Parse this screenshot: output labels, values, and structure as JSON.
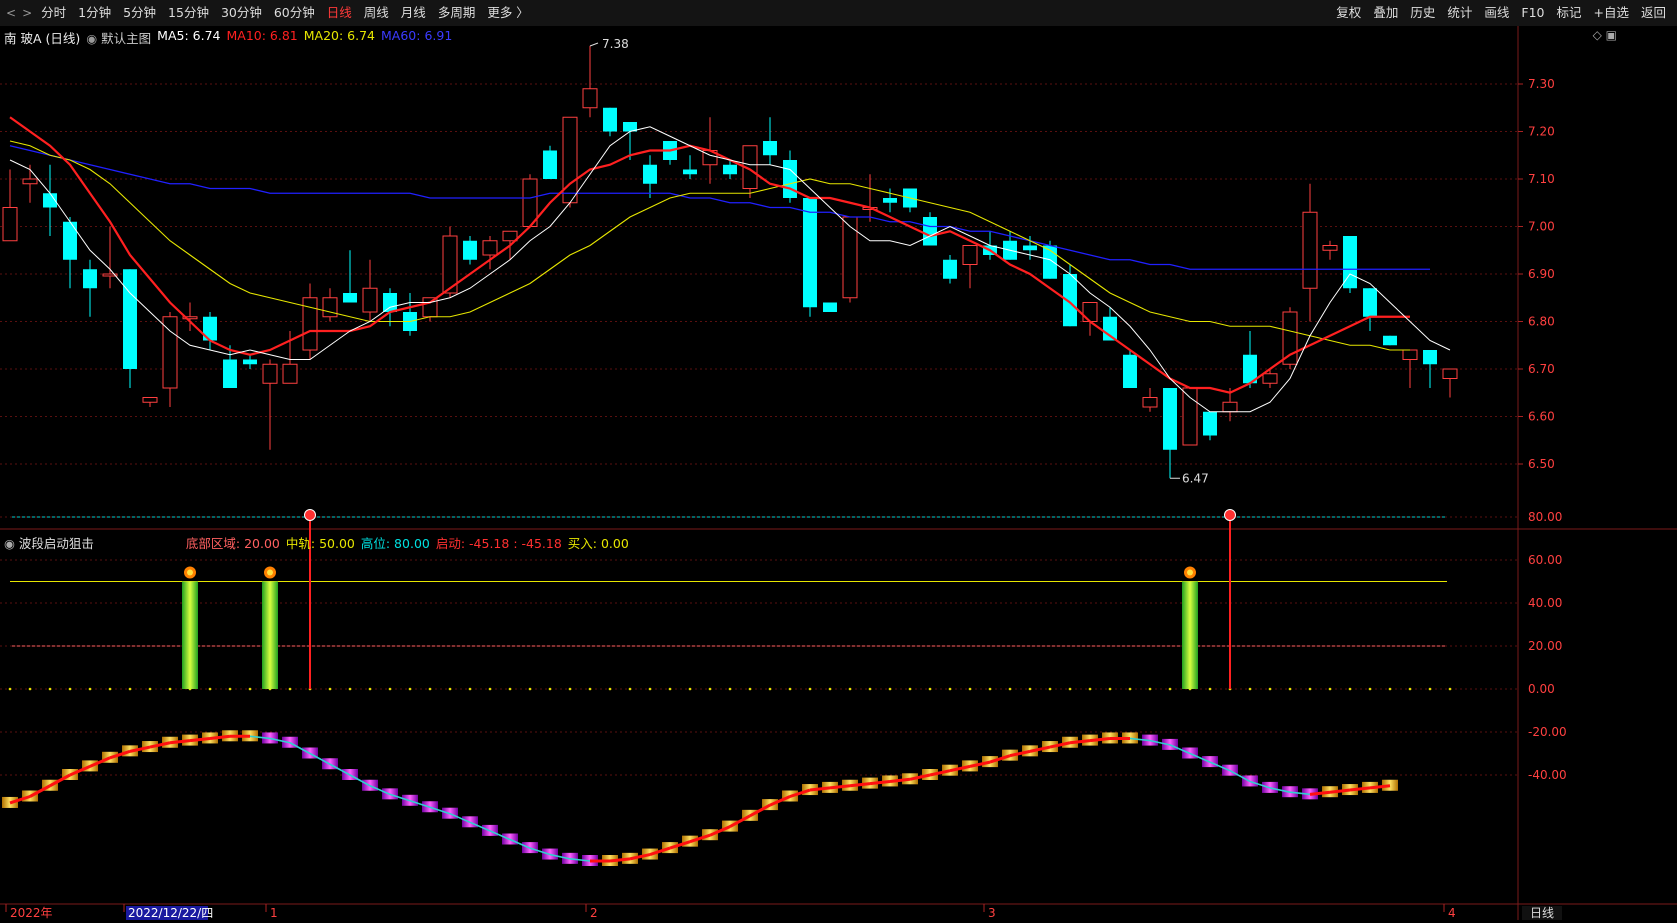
{
  "toolbar": {
    "nav_back": "<",
    "nav_fwd": ">",
    "periods": [
      "分时",
      "1分钟",
      "5分钟",
      "15分钟",
      "30分钟",
      "60分钟",
      "日线",
      "周线",
      "月线",
      "多周期",
      "更多 〉"
    ],
    "active_period": "日线",
    "right_items": [
      "复权",
      "叠加",
      "历史",
      "统计",
      "画线",
      "F10",
      "标记",
      "+自选",
      "返回"
    ]
  },
  "main_header": {
    "stock": "南 玻A (日线)",
    "template": "默认主图",
    "ma5": "MA5: 6.74",
    "ma10": "MA10: 6.81",
    "ma20": "MA20: 6.74",
    "ma60": "MA60: 6.91",
    "high_label": "7.38",
    "low_label": "6.47"
  },
  "indicator_header": {
    "name": "波段启动狙击",
    "bottom_zone": "底部区域: 20.00",
    "mid_rail": "中轨: 50.00",
    "high_pos": "高位: 80.00",
    "start": "启动: -45.18 : -45.18",
    "buy": "买入: 0.00"
  },
  "price_axis": [
    "7.30",
    "7.20",
    "7.10",
    "7.00",
    "6.90",
    "6.80",
    "6.70",
    "6.60",
    "6.50"
  ],
  "ind_axis": [
    "80.00",
    "60.00",
    "40.00",
    "20.00",
    "0.00",
    "-20.00",
    "-40.00"
  ],
  "date_axis": [
    "2022年",
    "2022/12/22/四",
    "1",
    "2",
    "3",
    "4"
  ],
  "period_label": "日线",
  "colors": {
    "up": "#ff4040",
    "down": "#00ffff",
    "ma5": "#ffffff",
    "ma10": "#ff2020",
    "ma20": "#e6e600",
    "ma60": "#2020ff",
    "accent": "#ff3a3a"
  },
  "chart_data": {
    "type": "candlestick",
    "candles": [
      {
        "o": 6.97,
        "h": 7.12,
        "l": 6.97,
        "c": 7.04
      },
      {
        "o": 7.09,
        "h": 7.13,
        "l": 7.05,
        "c": 7.1
      },
      {
        "o": 7.07,
        "h": 7.13,
        "l": 6.98,
        "c": 7.04
      },
      {
        "o": 7.01,
        "h": 7.02,
        "l": 6.87,
        "c": 6.93
      },
      {
        "o": 6.91,
        "h": 6.93,
        "l": 6.81,
        "c": 6.87
      },
      {
        "o": 6.9,
        "h": 7.0,
        "l": 6.87,
        "c": 6.9
      },
      {
        "o": 6.91,
        "h": 6.91,
        "l": 6.66,
        "c": 6.7
      },
      {
        "o": 6.63,
        "h": 6.64,
        "l": 6.62,
        "c": 6.64
      },
      {
        "o": 6.66,
        "h": 6.82,
        "l": 6.62,
        "c": 6.81
      },
      {
        "o": 6.81,
        "h": 6.84,
        "l": 6.78,
        "c": 6.81
      },
      {
        "o": 6.81,
        "h": 6.82,
        "l": 6.74,
        "c": 6.76
      },
      {
        "o": 6.72,
        "h": 6.75,
        "l": 6.66,
        "c": 6.66
      },
      {
        "o": 6.72,
        "h": 6.73,
        "l": 6.7,
        "c": 6.71
      },
      {
        "o": 6.67,
        "h": 6.72,
        "l": 6.53,
        "c": 6.71
      },
      {
        "o": 6.67,
        "h": 6.78,
        "l": 6.67,
        "c": 6.71
      },
      {
        "o": 6.74,
        "h": 6.88,
        "l": 6.72,
        "c": 6.85
      },
      {
        "o": 6.81,
        "h": 6.87,
        "l": 6.8,
        "c": 6.85
      },
      {
        "o": 6.86,
        "h": 6.95,
        "l": 6.84,
        "c": 6.84
      },
      {
        "o": 6.82,
        "h": 6.93,
        "l": 6.8,
        "c": 6.87
      },
      {
        "o": 6.86,
        "h": 6.87,
        "l": 6.79,
        "c": 6.82
      },
      {
        "o": 6.82,
        "h": 6.86,
        "l": 6.77,
        "c": 6.78
      },
      {
        "o": 6.81,
        "h": 6.85,
        "l": 6.8,
        "c": 6.85
      },
      {
        "o": 6.86,
        "h": 7.0,
        "l": 6.85,
        "c": 6.98
      },
      {
        "o": 6.97,
        "h": 6.98,
        "l": 6.92,
        "c": 6.93
      },
      {
        "o": 6.94,
        "h": 6.98,
        "l": 6.91,
        "c": 6.97
      },
      {
        "o": 6.97,
        "h": 6.99,
        "l": 6.93,
        "c": 6.99
      },
      {
        "o": 7.0,
        "h": 7.11,
        "l": 7.0,
        "c": 7.1
      },
      {
        "o": 7.16,
        "h": 7.17,
        "l": 7.1,
        "c": 7.1
      },
      {
        "o": 7.05,
        "h": 7.21,
        "l": 7.04,
        "c": 7.23
      },
      {
        "o": 7.25,
        "h": 7.38,
        "l": 7.23,
        "c": 7.29
      },
      {
        "o": 7.25,
        "h": 7.25,
        "l": 7.19,
        "c": 7.2
      },
      {
        "o": 7.22,
        "h": 7.22,
        "l": 7.14,
        "c": 7.2
      },
      {
        "o": 7.13,
        "h": 7.15,
        "l": 7.06,
        "c": 7.09
      },
      {
        "o": 7.18,
        "h": 7.18,
        "l": 7.13,
        "c": 7.14
      },
      {
        "o": 7.12,
        "h": 7.15,
        "l": 7.1,
        "c": 7.11
      },
      {
        "o": 7.13,
        "h": 7.23,
        "l": 7.09,
        "c": 7.16
      },
      {
        "o": 7.13,
        "h": 7.14,
        "l": 7.1,
        "c": 7.11
      },
      {
        "o": 7.08,
        "h": 7.15,
        "l": 7.06,
        "c": 7.17
      },
      {
        "o": 7.18,
        "h": 7.23,
        "l": 7.13,
        "c": 7.15
      },
      {
        "o": 7.14,
        "h": 7.16,
        "l": 7.05,
        "c": 7.06
      },
      {
        "o": 7.06,
        "h": 7.06,
        "l": 6.81,
        "c": 6.83
      },
      {
        "o": 6.84,
        "h": 6.84,
        "l": 6.82,
        "c": 6.82
      },
      {
        "o": 6.85,
        "h": 7.02,
        "l": 6.84,
        "c": 7.02
      },
      {
        "o": 7.04,
        "h": 7.11,
        "l": 7.01,
        "c": 7.04
      },
      {
        "o": 7.06,
        "h": 7.08,
        "l": 7.03,
        "c": 7.05
      },
      {
        "o": 7.08,
        "h": 7.08,
        "l": 7.03,
        "c": 7.04
      },
      {
        "o": 7.02,
        "h": 7.03,
        "l": 6.96,
        "c": 6.96
      },
      {
        "o": 6.93,
        "h": 6.94,
        "l": 6.88,
        "c": 6.89
      },
      {
        "o": 6.92,
        "h": 6.96,
        "l": 6.87,
        "c": 6.96
      },
      {
        "o": 6.96,
        "h": 6.99,
        "l": 6.93,
        "c": 6.94
      },
      {
        "o": 6.97,
        "h": 6.99,
        "l": 6.93,
        "c": 6.93
      },
      {
        "o": 6.96,
        "h": 6.98,
        "l": 6.93,
        "c": 6.95
      },
      {
        "o": 6.96,
        "h": 6.97,
        "l": 6.89,
        "c": 6.89
      },
      {
        "o": 6.9,
        "h": 6.92,
        "l": 6.79,
        "c": 6.79
      },
      {
        "o": 6.8,
        "h": 6.81,
        "l": 6.77,
        "c": 6.84
      },
      {
        "o": 6.81,
        "h": 6.83,
        "l": 6.76,
        "c": 6.76
      },
      {
        "o": 6.73,
        "h": 6.74,
        "l": 6.66,
        "c": 6.66
      },
      {
        "o": 6.62,
        "h": 6.66,
        "l": 6.61,
        "c": 6.64
      },
      {
        "o": 6.66,
        "h": 6.66,
        "l": 6.47,
        "c": 6.53
      },
      {
        "o": 6.54,
        "h": 6.66,
        "l": 6.54,
        "c": 6.66
      },
      {
        "o": 6.61,
        "h": 6.61,
        "l": 6.55,
        "c": 6.56
      },
      {
        "o": 6.61,
        "h": 6.66,
        "l": 6.59,
        "c": 6.63
      },
      {
        "o": 6.73,
        "h": 6.78,
        "l": 6.66,
        "c": 6.67
      },
      {
        "o": 6.67,
        "h": 6.7,
        "l": 6.66,
        "c": 6.69
      },
      {
        "o": 6.71,
        "h": 6.83,
        "l": 6.7,
        "c": 6.82
      },
      {
        "o": 6.87,
        "h": 7.09,
        "l": 6.8,
        "c": 7.03
      },
      {
        "o": 6.95,
        "h": 6.97,
        "l": 6.93,
        "c": 6.96
      },
      {
        "o": 6.98,
        "h": 6.98,
        "l": 6.86,
        "c": 6.87
      },
      {
        "o": 6.87,
        "h": 6.87,
        "l": 6.78,
        "c": 6.81
      },
      {
        "o": 6.77,
        "h": 6.77,
        "l": 6.75,
        "c": 6.75
      },
      {
        "o": 6.72,
        "h": 6.74,
        "l": 6.66,
        "c": 6.74
      },
      {
        "o": 6.74,
        "h": 6.74,
        "l": 6.66,
        "c": 6.71
      },
      {
        "o": 6.68,
        "h": 6.7,
        "l": 6.64,
        "c": 6.7
      }
    ],
    "ma5": [
      7.14,
      7.12,
      7.07,
      7.01,
      6.95,
      6.91,
      6.86,
      6.82,
      6.78,
      6.75,
      6.74,
      6.73,
      6.74,
      6.73,
      6.72,
      6.72,
      6.75,
      6.78,
      6.8,
      6.83,
      6.84,
      6.84,
      6.85,
      6.87,
      6.9,
      6.93,
      6.97,
      7.0,
      7.05,
      7.11,
      7.17,
      7.2,
      7.21,
      7.19,
      7.17,
      7.15,
      7.14,
      7.13,
      7.13,
      7.12,
      7.08,
      7.04,
      7.0,
      6.97,
      6.97,
      6.96,
      6.98,
      7.0,
      6.98,
      6.96,
      6.95,
      6.94,
      6.93,
      6.9,
      6.86,
      6.83,
      6.79,
      6.74,
      6.68,
      6.64,
      6.61,
      6.61,
      6.61,
      6.63,
      6.68,
      6.77,
      6.84,
      6.9,
      6.88,
      6.84,
      6.8,
      6.76,
      6.74
    ],
    "ma10": [
      7.23,
      7.2,
      7.17,
      7.13,
      7.07,
      7.01,
      6.94,
      6.89,
      6.84,
      6.8,
      6.76,
      6.74,
      6.73,
      6.74,
      6.76,
      6.78,
      6.78,
      6.78,
      6.79,
      6.82,
      6.83,
      6.84,
      6.87,
      6.9,
      6.93,
      6.96,
      7.0,
      7.05,
      7.09,
      7.12,
      7.13,
      7.15,
      7.16,
      7.16,
      7.17,
      7.16,
      7.14,
      7.12,
      7.09,
      7.08,
      7.06,
      7.06,
      7.05,
      7.04,
      7.02,
      7.0,
      6.98,
      6.99,
      6.97,
      6.95,
      6.92,
      6.9,
      6.87,
      6.84,
      6.8,
      6.77,
      6.74,
      6.71,
      6.68,
      6.66,
      6.66,
      6.65,
      6.67,
      6.7,
      6.73,
      6.75,
      6.77,
      6.79,
      6.81,
      6.81,
      6.81
    ],
    "ma20": [
      7.18,
      7.17,
      7.15,
      7.14,
      7.12,
      7.09,
      7.05,
      7.01,
      6.97,
      6.94,
      6.91,
      6.88,
      6.86,
      6.85,
      6.84,
      6.83,
      6.82,
      6.81,
      6.8,
      6.8,
      6.8,
      6.81,
      6.81,
      6.82,
      6.84,
      6.86,
      6.88,
      6.91,
      6.94,
      6.96,
      6.99,
      7.02,
      7.04,
      7.06,
      7.07,
      7.07,
      7.07,
      7.07,
      7.08,
      7.09,
      7.1,
      7.09,
      7.09,
      7.08,
      7.07,
      7.06,
      7.05,
      7.04,
      7.03,
      7.01,
      6.99,
      6.97,
      6.95,
      6.92,
      6.89,
      6.86,
      6.84,
      6.82,
      6.81,
      6.8,
      6.8,
      6.79,
      6.79,
      6.79,
      6.78,
      6.77,
      6.76,
      6.75,
      6.75,
      6.74,
      6.74
    ],
    "ma60": [
      7.17,
      7.16,
      7.15,
      7.14,
      7.13,
      7.12,
      7.11,
      7.1,
      7.09,
      7.09,
      7.08,
      7.08,
      7.08,
      7.07,
      7.07,
      7.07,
      7.07,
      7.07,
      7.07,
      7.07,
      7.07,
      7.06,
      7.06,
      7.06,
      7.06,
      7.06,
      7.06,
      7.07,
      7.07,
      7.07,
      7.07,
      7.07,
      7.07,
      7.07,
      7.06,
      7.06,
      7.05,
      7.05,
      7.04,
      7.04,
      7.03,
      7.03,
      7.02,
      7.02,
      7.01,
      7.01,
      7.0,
      7.0,
      6.99,
      6.99,
      6.98,
      6.97,
      6.96,
      6.95,
      6.94,
      6.93,
      6.93,
      6.92,
      6.92,
      6.91,
      6.91,
      6.91,
      6.91,
      6.91,
      6.91,
      6.91,
      6.91,
      6.91,
      6.91,
      6.91,
      6.91,
      6.91
    ],
    "indicator": {
      "levels": [
        80,
        50,
        20
      ],
      "buy_bars_at": [
        9,
        13,
        59
      ],
      "signal_lines_at": [
        15,
        61
      ],
      "osc": [
        -53,
        -50,
        -45,
        -40,
        -36,
        -32,
        -29,
        -27,
        -25,
        -24,
        -23,
        -22,
        -22,
        -23,
        -25,
        -30,
        -35,
        -40,
        -45,
        -49,
        -52,
        -55,
        -58,
        -62,
        -66,
        -70,
        -74,
        -77,
        -79,
        -80,
        -80,
        -79,
        -77,
        -74,
        -71,
        -68,
        -64,
        -59,
        -54,
        -50,
        -47,
        -46,
        -45,
        -44,
        -43,
        -42,
        -40,
        -38,
        -36,
        -34,
        -31,
        -29,
        -27,
        -25,
        -24,
        -23,
        -23,
        -24,
        -26,
        -30,
        -34,
        -38,
        -43,
        -46,
        -48,
        -49,
        -48,
        -47,
        -46,
        -45
      ]
    }
  }
}
